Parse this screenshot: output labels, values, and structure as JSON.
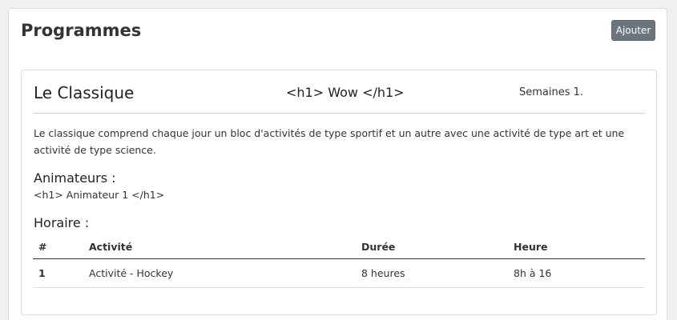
{
  "header": {
    "title": "Programmes",
    "add_label": "Ajouter"
  },
  "program": {
    "name": "Le Classique",
    "subtitle": "<h1> Wow </h1>",
    "weeks": "Semaines 1.",
    "description": "Le classique comprend chaque jour un bloc d'activités de type sportif et un autre avec une activité de type art et une activité de type science.",
    "animateurs_label": "Animateurs :",
    "animateurs_value": "<h1> Animateur 1 </h1>",
    "horaire_label": "Horaire :",
    "schedule": {
      "columns": [
        "#",
        "Activité",
        "Durée",
        "Heure"
      ],
      "rows": [
        [
          "1",
          "Activité - Hockey",
          "8 heures",
          "8h à 16"
        ]
      ]
    }
  },
  "colors": {
    "page_bg": "#f0f0f0",
    "card_bg": "#ffffff",
    "button_bg": "#6c757d"
  }
}
